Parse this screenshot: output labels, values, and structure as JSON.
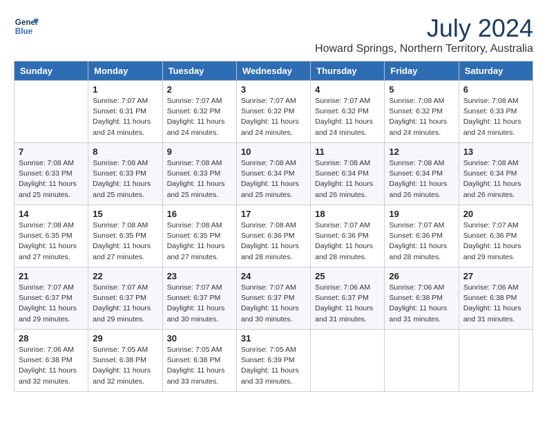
{
  "header": {
    "logo_line1": "General",
    "logo_line2": "Blue",
    "title": "July 2024",
    "subtitle": "Howard Springs, Northern Territory, Australia"
  },
  "weekdays": [
    "Sunday",
    "Monday",
    "Tuesday",
    "Wednesday",
    "Thursday",
    "Friday",
    "Saturday"
  ],
  "weeks": [
    [
      {
        "day": "",
        "sunrise": "",
        "sunset": "",
        "daylight": ""
      },
      {
        "day": "1",
        "sunrise": "Sunrise: 7:07 AM",
        "sunset": "Sunset: 6:31 PM",
        "daylight": "Daylight: 11 hours and 24 minutes."
      },
      {
        "day": "2",
        "sunrise": "Sunrise: 7:07 AM",
        "sunset": "Sunset: 6:32 PM",
        "daylight": "Daylight: 11 hours and 24 minutes."
      },
      {
        "day": "3",
        "sunrise": "Sunrise: 7:07 AM",
        "sunset": "Sunset: 6:32 PM",
        "daylight": "Daylight: 11 hours and 24 minutes."
      },
      {
        "day": "4",
        "sunrise": "Sunrise: 7:07 AM",
        "sunset": "Sunset: 6:32 PM",
        "daylight": "Daylight: 11 hours and 24 minutes."
      },
      {
        "day": "5",
        "sunrise": "Sunrise: 7:08 AM",
        "sunset": "Sunset: 6:32 PM",
        "daylight": "Daylight: 11 hours and 24 minutes."
      },
      {
        "day": "6",
        "sunrise": "Sunrise: 7:08 AM",
        "sunset": "Sunset: 6:33 PM",
        "daylight": "Daylight: 11 hours and 24 minutes."
      }
    ],
    [
      {
        "day": "7",
        "sunrise": "Sunrise: 7:08 AM",
        "sunset": "Sunset: 6:33 PM",
        "daylight": "Daylight: 11 hours and 25 minutes."
      },
      {
        "day": "8",
        "sunrise": "Sunrise: 7:08 AM",
        "sunset": "Sunset: 6:33 PM",
        "daylight": "Daylight: 11 hours and 25 minutes."
      },
      {
        "day": "9",
        "sunrise": "Sunrise: 7:08 AM",
        "sunset": "Sunset: 6:33 PM",
        "daylight": "Daylight: 11 hours and 25 minutes."
      },
      {
        "day": "10",
        "sunrise": "Sunrise: 7:08 AM",
        "sunset": "Sunset: 6:34 PM",
        "daylight": "Daylight: 11 hours and 25 minutes."
      },
      {
        "day": "11",
        "sunrise": "Sunrise: 7:08 AM",
        "sunset": "Sunset: 6:34 PM",
        "daylight": "Daylight: 11 hours and 26 minutes."
      },
      {
        "day": "12",
        "sunrise": "Sunrise: 7:08 AM",
        "sunset": "Sunset: 6:34 PM",
        "daylight": "Daylight: 11 hours and 26 minutes."
      },
      {
        "day": "13",
        "sunrise": "Sunrise: 7:08 AM",
        "sunset": "Sunset: 6:34 PM",
        "daylight": "Daylight: 11 hours and 26 minutes."
      }
    ],
    [
      {
        "day": "14",
        "sunrise": "Sunrise: 7:08 AM",
        "sunset": "Sunset: 6:35 PM",
        "daylight": "Daylight: 11 hours and 27 minutes."
      },
      {
        "day": "15",
        "sunrise": "Sunrise: 7:08 AM",
        "sunset": "Sunset: 6:35 PM",
        "daylight": "Daylight: 11 hours and 27 minutes."
      },
      {
        "day": "16",
        "sunrise": "Sunrise: 7:08 AM",
        "sunset": "Sunset: 6:35 PM",
        "daylight": "Daylight: 11 hours and 27 minutes."
      },
      {
        "day": "17",
        "sunrise": "Sunrise: 7:08 AM",
        "sunset": "Sunset: 6:36 PM",
        "daylight": "Daylight: 11 hours and 28 minutes."
      },
      {
        "day": "18",
        "sunrise": "Sunrise: 7:07 AM",
        "sunset": "Sunset: 6:36 PM",
        "daylight": "Daylight: 11 hours and 28 minutes."
      },
      {
        "day": "19",
        "sunrise": "Sunrise: 7:07 AM",
        "sunset": "Sunset: 6:36 PM",
        "daylight": "Daylight: 11 hours and 28 minutes."
      },
      {
        "day": "20",
        "sunrise": "Sunrise: 7:07 AM",
        "sunset": "Sunset: 6:36 PM",
        "daylight": "Daylight: 11 hours and 29 minutes."
      }
    ],
    [
      {
        "day": "21",
        "sunrise": "Sunrise: 7:07 AM",
        "sunset": "Sunset: 6:37 PM",
        "daylight": "Daylight: 11 hours and 29 minutes."
      },
      {
        "day": "22",
        "sunrise": "Sunrise: 7:07 AM",
        "sunset": "Sunset: 6:37 PM",
        "daylight": "Daylight: 11 hours and 29 minutes."
      },
      {
        "day": "23",
        "sunrise": "Sunrise: 7:07 AM",
        "sunset": "Sunset: 6:37 PM",
        "daylight": "Daylight: 11 hours and 30 minutes."
      },
      {
        "day": "24",
        "sunrise": "Sunrise: 7:07 AM",
        "sunset": "Sunset: 6:37 PM",
        "daylight": "Daylight: 11 hours and 30 minutes."
      },
      {
        "day": "25",
        "sunrise": "Sunrise: 7:06 AM",
        "sunset": "Sunset: 6:37 PM",
        "daylight": "Daylight: 11 hours and 31 minutes."
      },
      {
        "day": "26",
        "sunrise": "Sunrise: 7:06 AM",
        "sunset": "Sunset: 6:38 PM",
        "daylight": "Daylight: 11 hours and 31 minutes."
      },
      {
        "day": "27",
        "sunrise": "Sunrise: 7:06 AM",
        "sunset": "Sunset: 6:38 PM",
        "daylight": "Daylight: 11 hours and 31 minutes."
      }
    ],
    [
      {
        "day": "28",
        "sunrise": "Sunrise: 7:06 AM",
        "sunset": "Sunset: 6:38 PM",
        "daylight": "Daylight: 11 hours and 32 minutes."
      },
      {
        "day": "29",
        "sunrise": "Sunrise: 7:05 AM",
        "sunset": "Sunset: 6:38 PM",
        "daylight": "Daylight: 11 hours and 32 minutes."
      },
      {
        "day": "30",
        "sunrise": "Sunrise: 7:05 AM",
        "sunset": "Sunset: 6:38 PM",
        "daylight": "Daylight: 11 hours and 33 minutes."
      },
      {
        "day": "31",
        "sunrise": "Sunrise: 7:05 AM",
        "sunset": "Sunset: 6:39 PM",
        "daylight": "Daylight: 11 hours and 33 minutes."
      },
      {
        "day": "",
        "sunrise": "",
        "sunset": "",
        "daylight": ""
      },
      {
        "day": "",
        "sunrise": "",
        "sunset": "",
        "daylight": ""
      },
      {
        "day": "",
        "sunrise": "",
        "sunset": "",
        "daylight": ""
      }
    ]
  ]
}
